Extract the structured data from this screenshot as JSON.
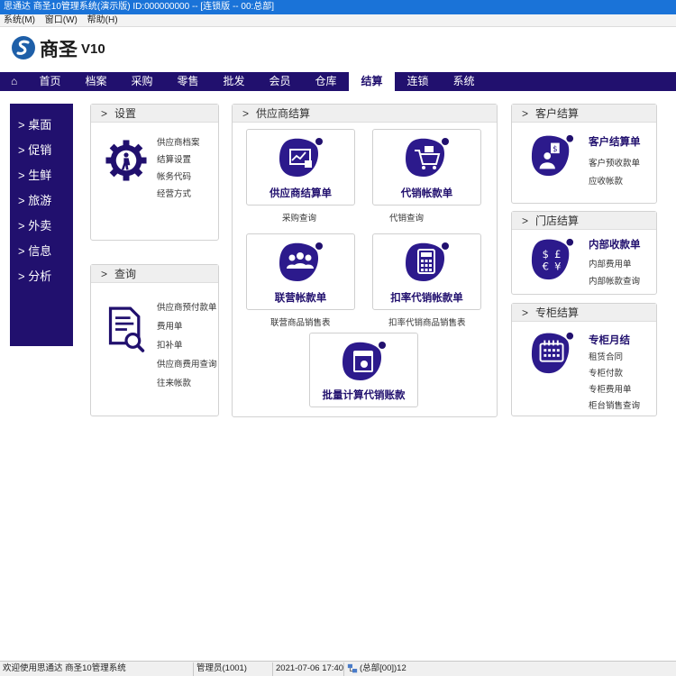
{
  "window": {
    "title": "思通达 商圣10管理系统(演示版) ID:000000000 -- [连锁版 -- 00:总部]"
  },
  "menu": {
    "items": [
      "系统(M)",
      "窗口(W)",
      "帮助(H)"
    ]
  },
  "brand": {
    "name": "商圣",
    "version": "V10"
  },
  "nav": {
    "items": [
      "首页",
      "档案",
      "采购",
      "零售",
      "批发",
      "会员",
      "仓库",
      "结算",
      "连锁",
      "系统"
    ],
    "active": "结算"
  },
  "sidebar": {
    "items": [
      "> 桌面",
      "> 促销",
      "> 生鲜",
      "> 旅游",
      "> 外卖",
      "> 信息",
      "> 分析"
    ]
  },
  "settings": {
    "title": "设置",
    "links": [
      "供应商档案",
      "结算设置",
      "帐务代码",
      "经营方式"
    ]
  },
  "query": {
    "title": "查询",
    "links": [
      "供应商预付款单",
      "费用单",
      "扣补单",
      "供应商费用查询",
      "往来帐款"
    ]
  },
  "supplier": {
    "title": "供应商结算",
    "tiles": {
      "t1": {
        "label": "供应商结算单",
        "sub": "采购查询"
      },
      "t2": {
        "label": "代销帐款单",
        "sub": "代销查询"
      },
      "t3": {
        "label": "联营帐款单",
        "sub": "联营商品销售表"
      },
      "t4": {
        "label": "扣率代销帐款单",
        "sub": "扣率代销商品销售表"
      },
      "t5": {
        "label": "批量计算代销账款"
      }
    }
  },
  "customer": {
    "title": "客户结算",
    "main": "客户结算单",
    "links": [
      "客户预收款单",
      "应收帐款"
    ]
  },
  "store": {
    "title": "门店结算",
    "main": "内部收款单",
    "links": [
      "内部费用单",
      "内部帐款查询"
    ]
  },
  "counter": {
    "title": "专柜结算",
    "main": "专柜月结",
    "links": [
      "租赁合同",
      "专柜付款",
      "专柜费用单",
      "柜台销售查询"
    ]
  },
  "status": {
    "welcome": "欢迎使用思通达 商圣10管理系统",
    "user": "管理员(1001)",
    "datetime": "2021-07-06 17:40",
    "branch": "(总部[00])12"
  },
  "colors": {
    "navy": "#21106e",
    "titlebar": "#1a73d8",
    "accent_dot": "#21106e"
  }
}
